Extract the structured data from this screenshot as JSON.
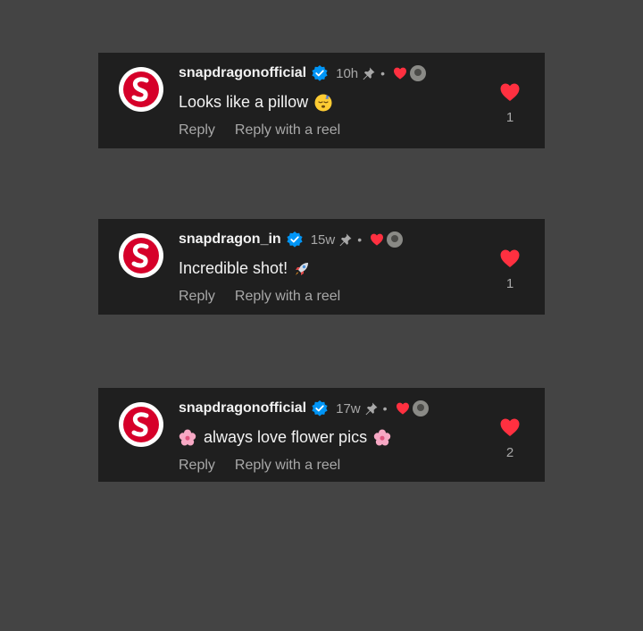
{
  "colors": {
    "background": "#444444",
    "card": "#1f1f1f",
    "heart": "#ff3040",
    "verified": "#0095f6",
    "muted_text": "#a8a8a8"
  },
  "comments": [
    {
      "username": "snapdragonofficial",
      "time": "10h",
      "separator": "•",
      "text": "Looks like a pillow",
      "emoji_after": "sleeping-face-emoji",
      "reply_label": "Reply",
      "reply_reel_label": "Reply with a reel",
      "like_count": "1"
    },
    {
      "username": "snapdragon_in",
      "time": "15w",
      "separator": "•",
      "text": "Incredible shot!",
      "emoji_after": "rocket-emoji",
      "reply_label": "Reply",
      "reply_reel_label": "Reply with a reel",
      "like_count": "1"
    },
    {
      "username": "snapdragonofficial",
      "time": "17w",
      "separator": "•",
      "text": "always love flower pics",
      "emoji_before": "cherry-blossom-emoji",
      "emoji_after": "cherry-blossom-emoji",
      "reply_label": "Reply",
      "reply_reel_label": "Reply with a reel",
      "like_count": "2"
    }
  ]
}
